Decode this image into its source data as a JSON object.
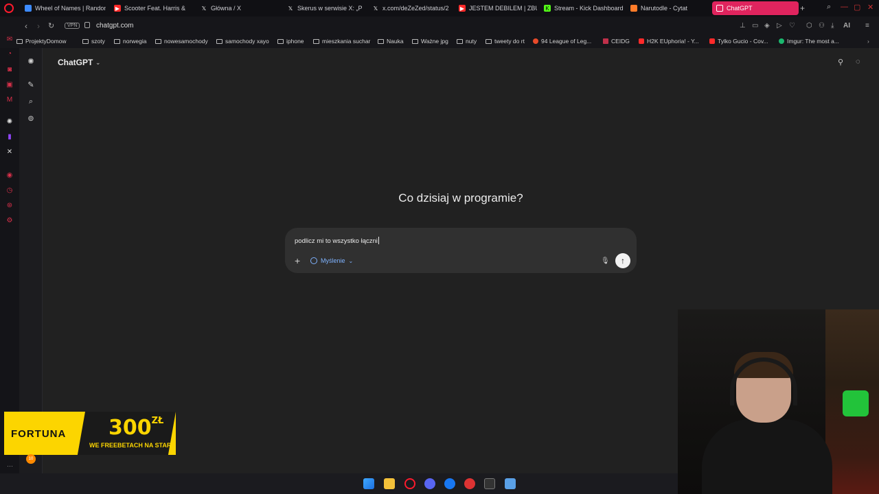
{
  "browser": {
    "tabs": [
      {
        "title": "Wheel of Names | Random",
        "color": "#3d8bff"
      },
      {
        "title": "Scooter Feat. Harris &",
        "color": "#ff2a2a"
      },
      {
        "title": "Główna / X",
        "color": "#555555"
      },
      {
        "title": "Skerus w serwisie X: „P",
        "color": "#555555"
      },
      {
        "title": "x.com/deZeZed/status/2",
        "color": "#555555"
      },
      {
        "title": "JESTEM DEBILEM | ZBUD",
        "color": "#ff2a2a"
      },
      {
        "title": "Stream - Kick Dashboard",
        "color": "#53fc18"
      },
      {
        "title": "Narutodle - Cytat",
        "color": "#ff7b29"
      },
      {
        "title": "ChatGPT",
        "color": "#ffffff"
      }
    ],
    "url": "chatgpt.com",
    "vpn_label": "VPN",
    "ai_label": "AI",
    "bookmarks": [
      {
        "label": "ProjektyDomow",
        "type": "folder"
      },
      {
        "label": "szoty",
        "type": "folder"
      },
      {
        "label": "norwegia",
        "type": "folder"
      },
      {
        "label": "nowesamochody",
        "type": "folder"
      },
      {
        "label": "samochody xayo",
        "type": "folder"
      },
      {
        "label": "iphone",
        "type": "folder"
      },
      {
        "label": "mieszkania suchar",
        "type": "folder"
      },
      {
        "label": "Nauka",
        "type": "folder"
      },
      {
        "label": "Ważne jpg",
        "type": "folder"
      },
      {
        "label": "nuty",
        "type": "folder"
      },
      {
        "label": "tweety do rt",
        "type": "folder"
      },
      {
        "label": "94 League of Leg...",
        "type": "site",
        "color": "#e84a2a"
      },
      {
        "label": "CEIDG",
        "type": "site",
        "color": "#c0304a"
      },
      {
        "label": "H2K EUphoria! - Y...",
        "type": "site",
        "color": "#ff2a2a"
      },
      {
        "label": "Tylko Gucio - Cov...",
        "type": "site",
        "color": "#ff2a2a"
      },
      {
        "label": "Imgur: The most a...",
        "type": "site",
        "color": "#1bb76e"
      }
    ]
  },
  "chatgpt": {
    "model_label": "ChatGPT",
    "heading": "Co dzisiaj w programie?",
    "composer_text": "podlicz mi to wszystko łączni",
    "mode_label": "Myślenie"
  },
  "overlay": {
    "brand": "FORTUNA",
    "amount": "300",
    "currency": "ZŁ",
    "tagline": "WE FREEBETACH NA START",
    "badge_count": "10"
  }
}
